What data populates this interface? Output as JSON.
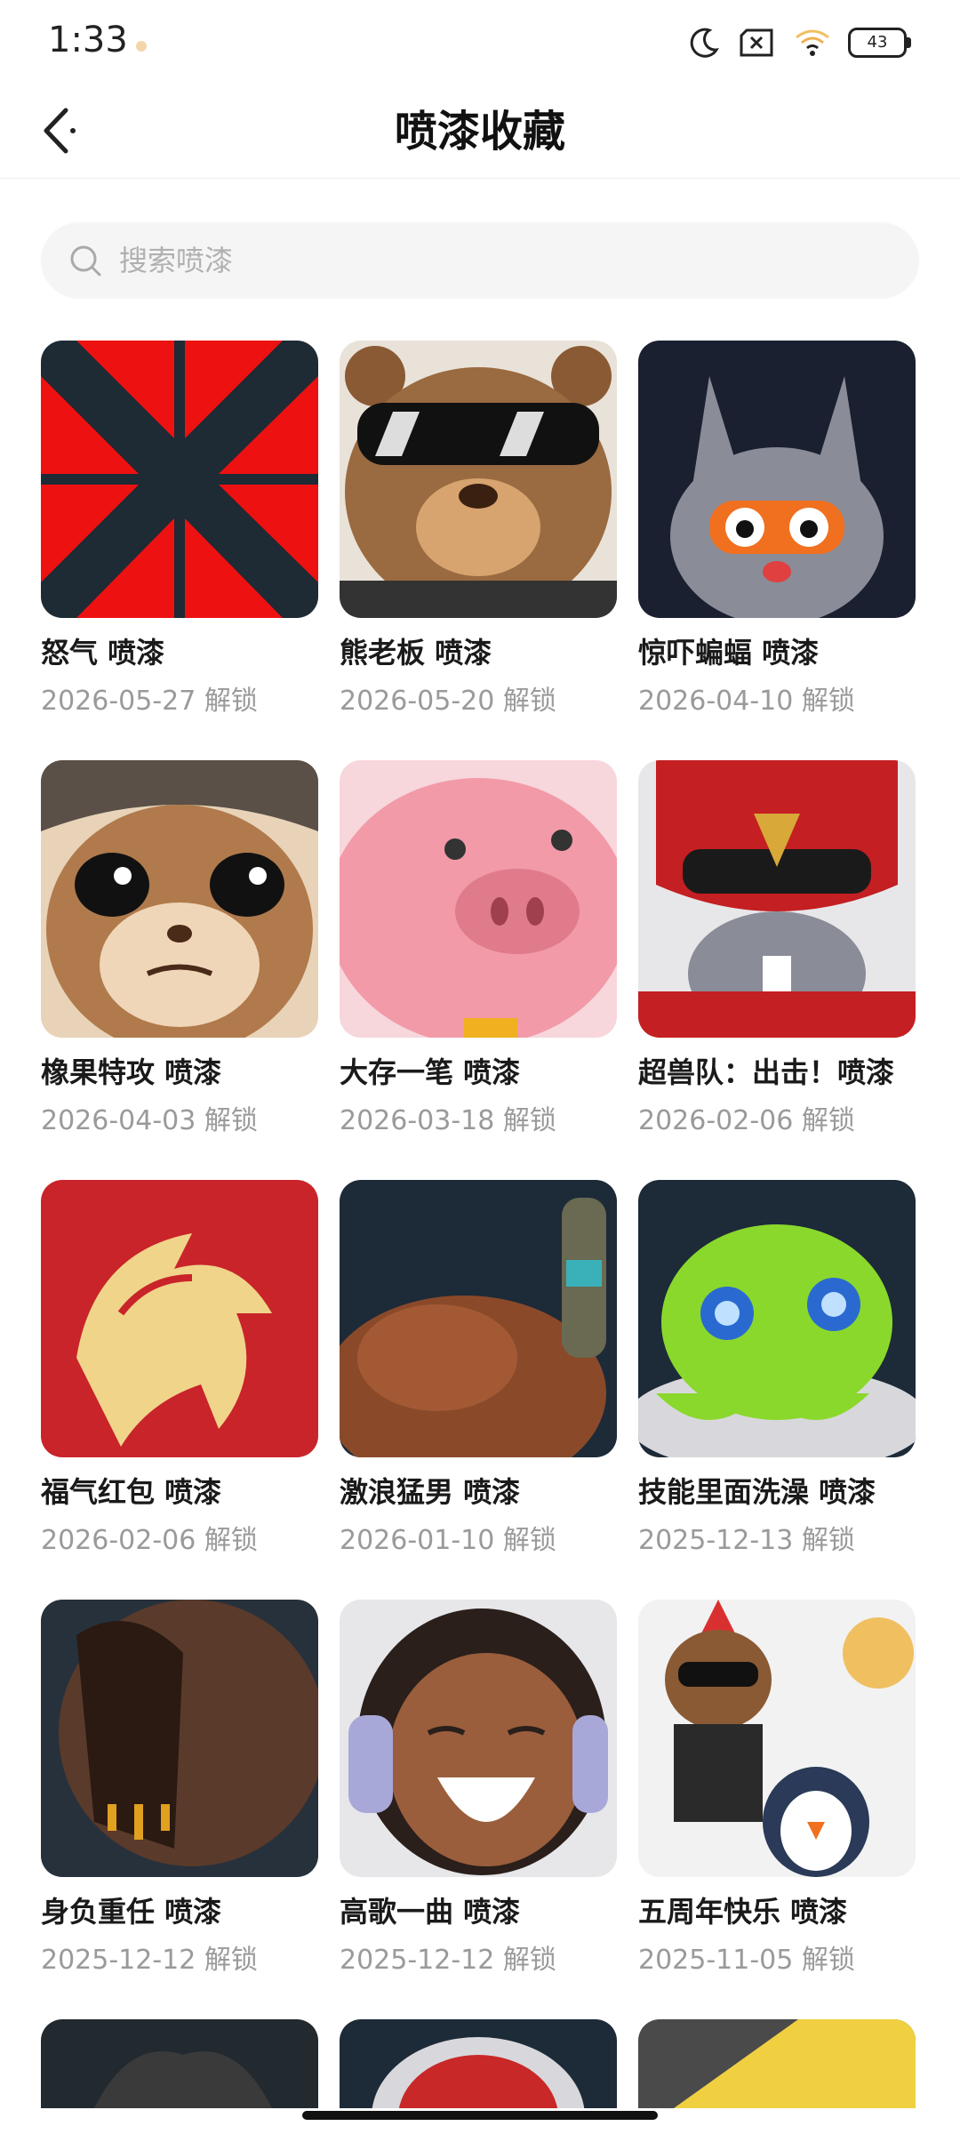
{
  "status": {
    "time": "1:33",
    "battery": "43"
  },
  "header": {
    "title": "喷漆收藏"
  },
  "search": {
    "placeholder": "搜索喷漆"
  },
  "items": [
    {
      "name": "怒气 喷漆",
      "date": "2026-05-27 解锁"
    },
    {
      "name": "熊老板 喷漆",
      "date": "2026-05-20 解锁"
    },
    {
      "name": "惊吓蝙蝠 喷漆",
      "date": "2026-04-10 解锁"
    },
    {
      "name": "橡果特攻 喷漆",
      "date": "2026-04-03 解锁"
    },
    {
      "name": "大存一笔 喷漆",
      "date": "2026-03-18 解锁"
    },
    {
      "name": "超兽队：出击！喷漆",
      "date": "2026-02-06 解锁"
    },
    {
      "name": "福气红包 喷漆",
      "date": "2026-02-06 解锁"
    },
    {
      "name": "激浪猛男 喷漆",
      "date": "2026-01-10 解锁"
    },
    {
      "name": "技能里面洗澡 喷漆",
      "date": "2025-12-13 解锁"
    },
    {
      "name": "身负重任 喷漆",
      "date": "2025-12-12 解锁"
    },
    {
      "name": "高歌一曲 喷漆",
      "date": "2025-12-12 解锁"
    },
    {
      "name": "五周年快乐 喷漆",
      "date": "2025-11-05 解锁"
    }
  ]
}
